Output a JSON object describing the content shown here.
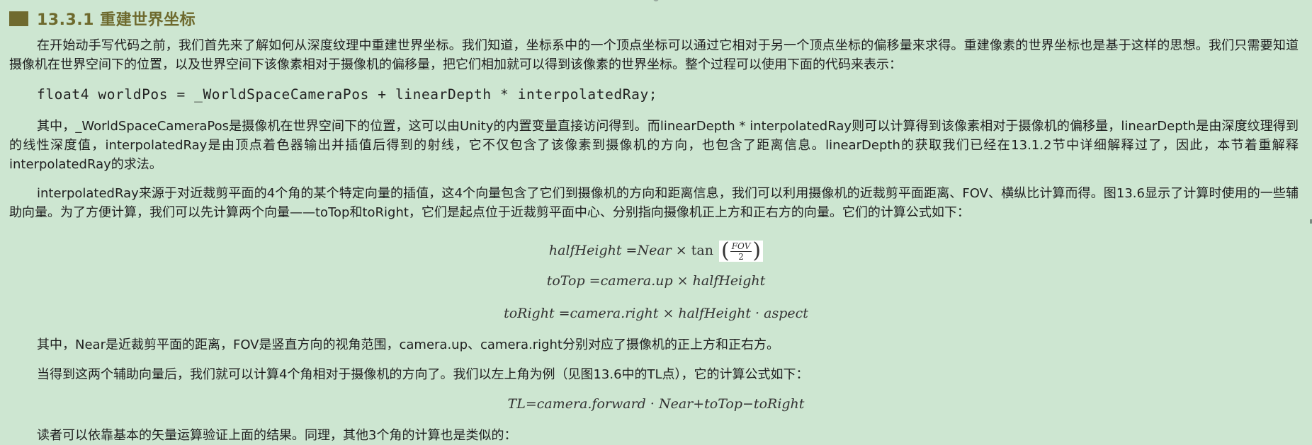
{
  "heading": "13.3.1 重建世界坐标",
  "paragraphs": [
    "在开始动手写代码之前，我们首先来了解如何从深度纹理中重建世界坐标。我们知道，坐标系中的一个顶点坐标可以通过它相对于另一个顶点坐标的偏移量来求得。重建像素的世界坐标也是基于这样的思想。我们只需要知道摄像机在世界空间下的位置，以及世界空间下该像素相对于摄像机的偏移量，把它们相加就可以得到该像素的世界坐标。整个过程可以使用下面的代码来表示：",
    "其中，_WorldSpaceCameraPos是摄像机在世界空间下的位置，这可以由Unity的内置变量直接访问得到。而linearDepth * interpolatedRay则可以计算得到该像素相对于摄像机的偏移量，linearDepth是由深度纹理得到的线性深度值，interpolatedRay是由顶点着色器输出并插值后得到的射线，它不仅包含了该像素到摄像机的方向，也包含了距离信息。linearDepth的获取我们已经在13.1.2节中详细解释过了，因此，本节着重解释interpolatedRay的求法。",
    "interpolatedRay来源于对近裁剪平面的4个角的某个特定向量的插值，这4个向量包含了它们到摄像机的方向和距离信息，我们可以利用摄像机的近裁剪平面距离、FOV、横纵比计算而得。图13.6显示了计算时使用的一些辅助向量。为了方便计算，我们可以先计算两个向量——toTop和toRight，它们是起点位于近裁剪平面中心、分别指向摄像机正上方和正右方的向量。它们的计算公式如下：",
    "其中，Near是近裁剪平面的距离，FOV是竖直方向的视角范围，camera.up、camera.right分别对应了摄像机的正上方和正右方。",
    "当得到这两个辅助向量后，我们就可以计算4个角相对于摄像机的方向了。我们以左上角为例（见图13.6中的TL点），它的计算公式如下：",
    "读者可以依靠基本的矢量运算验证上面的结果。同理，其他3个角的计算也是类似的："
  ],
  "code": "float4 worldPos = _WorldSpaceCameraPos + linearDepth * interpolatedRay;",
  "formulas": {
    "half_height": {
      "lhs": "halfHeight",
      "eq": " =",
      "near": "Near",
      "times": " × ",
      "tan": "tan",
      "num": "FOV",
      "den": "2"
    },
    "to_top": "toTop =camera.up × halfHeight",
    "to_right": "toRight =camera.right × halfHeight · aspect",
    "tl": "TL=camera.forward · Near+toTop−toRight"
  }
}
